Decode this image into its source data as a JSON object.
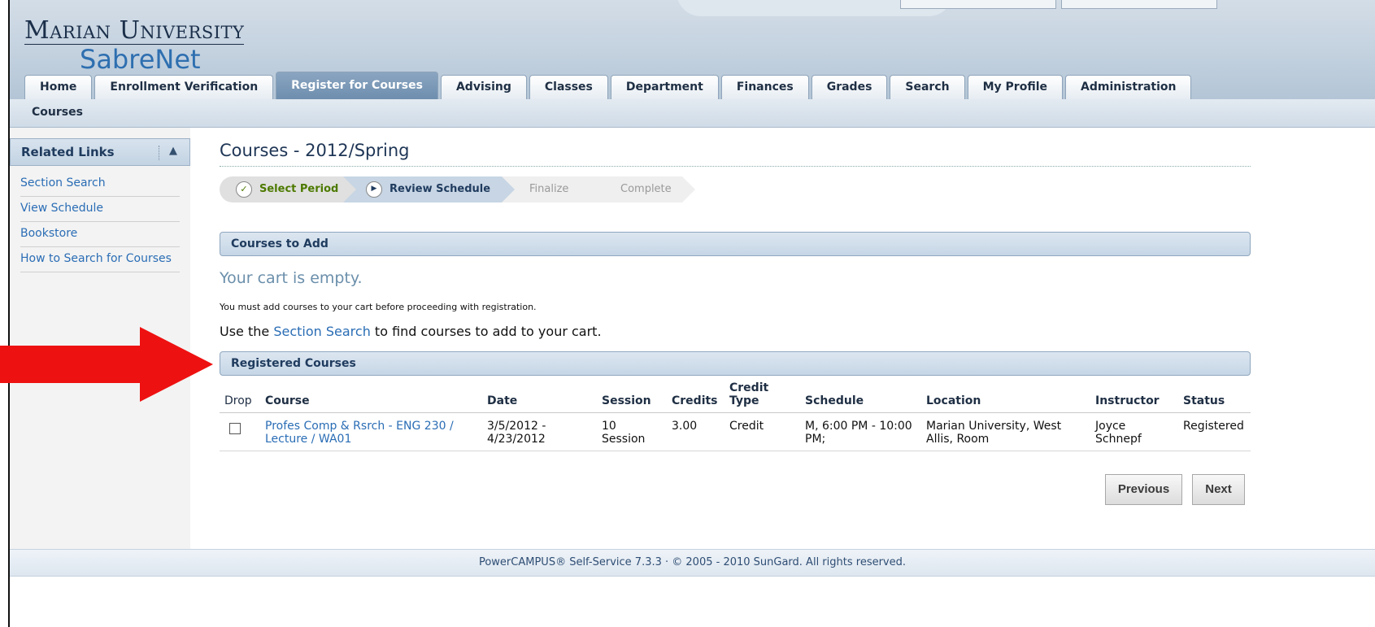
{
  "brand": {
    "name": "Marian University",
    "product": "SabreNet"
  },
  "tabs": [
    {
      "label": "Home",
      "active": false
    },
    {
      "label": "Enrollment Verification",
      "active": false
    },
    {
      "label": "Register for Courses",
      "active": true
    },
    {
      "label": "Advising",
      "active": false
    },
    {
      "label": "Classes",
      "active": false
    },
    {
      "label": "Department",
      "active": false
    },
    {
      "label": "Finances",
      "active": false
    },
    {
      "label": "Grades",
      "active": false
    },
    {
      "label": "Search",
      "active": false
    },
    {
      "label": "My Profile",
      "active": false
    },
    {
      "label": "Administration",
      "active": false
    }
  ],
  "subnav": {
    "label": "Courses"
  },
  "sidebar": {
    "title": "Related Links",
    "collapse_icon": "triangle-up-icon",
    "items": [
      {
        "label": "Section Search"
      },
      {
        "label": "View Schedule"
      },
      {
        "label": "Bookstore"
      },
      {
        "label": "How to Search for Courses"
      }
    ]
  },
  "page": {
    "title": "Courses - 2012/Spring"
  },
  "wizard": {
    "steps": [
      {
        "label": "Select Period",
        "state": "done",
        "icon": "check-icon"
      },
      {
        "label": "Review Schedule",
        "state": "current",
        "icon": "play-icon"
      },
      {
        "label": "Finalize",
        "state": "pending"
      },
      {
        "label": "Complete",
        "state": "pending"
      }
    ]
  },
  "cart": {
    "section_title": "Courses to Add",
    "empty_title": "Your cart is empty.",
    "note": "You must add courses to your cart before proceeding with registration.",
    "use_prefix": "Use the ",
    "use_link": "Section Search",
    "use_suffix": " to find courses to add to your cart."
  },
  "registered": {
    "section_title": "Registered Courses",
    "columns": {
      "drop": "Drop",
      "course": "Course",
      "date": "Date",
      "session": "Session",
      "credits": "Credits",
      "credit_type_line1": "Credit",
      "credit_type_line2": "Type",
      "schedule": "Schedule",
      "location": "Location",
      "instructor": "Instructor",
      "status": "Status"
    },
    "rows": [
      {
        "drop_checked": false,
        "course": "Profes Comp & Rsrch - ENG 230 / Lecture / WA01",
        "date": "3/5/2012 - 4/23/2012",
        "session": "10 Session",
        "credits": "3.00",
        "credit_type": "Credit",
        "schedule": "M, 6:00 PM - 10:00 PM;",
        "location": "Marian University, West Allis, Room",
        "instructor": "Joyce Schnepf",
        "status": "Registered"
      }
    ]
  },
  "buttons": {
    "previous": "Previous",
    "next": "Next"
  },
  "footer": {
    "text": "PowerCAMPUS® Self-Service 7.3.3 · © 2005 - 2010 SunGard. All rights reserved."
  },
  "colors": {
    "accent": "#2a6db5",
    "arrow": "#ee1111",
    "active_tab": "#7a97b6"
  }
}
